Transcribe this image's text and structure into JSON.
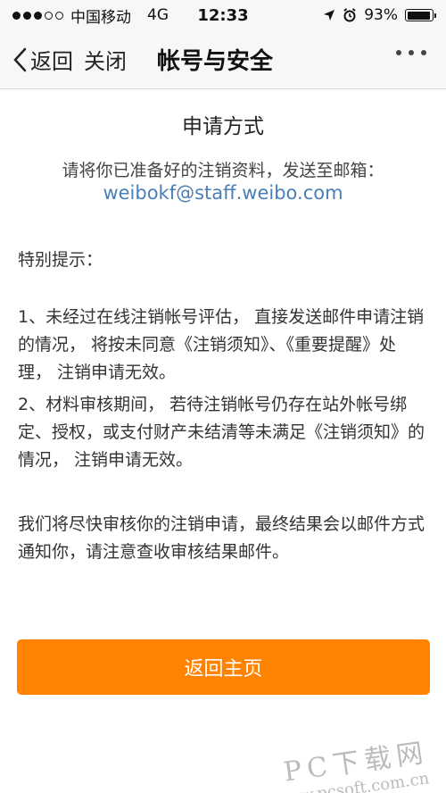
{
  "status_bar": {
    "carrier": "中国移动",
    "network": "4G",
    "time": "12:33",
    "battery": "93%",
    "battery_level": 0.93,
    "signal_bars": 3,
    "signal_total": 5
  },
  "nav": {
    "back_label": "返回",
    "close_label": "关闭",
    "title": "帐号与安全"
  },
  "content": {
    "heading": "申请方式",
    "instruction": "请将你已准备好的注销资料，发送至邮箱：",
    "email": "weibokf@staff.weibo.com",
    "tip_title": "特别提示：",
    "paragraph1": "1、未经过在线注销帐号评估， 直接发送邮件申请注销的情况， 将按未同意《注销须知》、《重要提醒》处理， 注销申请无效。",
    "paragraph2": "2、材料审核期间， 若待注销帐号仍存在站外帐号绑定、授权，或支付财产未结清等未满足《注销须知》的情况， 注销申请无效。",
    "paragraph3": "我们将尽快审核你的注销申请，最终结果会以邮件方式通知你，请注意查收审核结果邮件。"
  },
  "button": {
    "home_label": "返回主页"
  },
  "watermark": {
    "main": "PC下载网",
    "sub": "www.pcsoft.com.cn"
  },
  "colors": {
    "accent": "#ff8200",
    "link": "#4a7fb8"
  }
}
